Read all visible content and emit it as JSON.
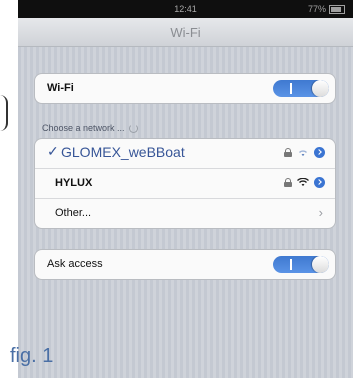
{
  "status_bar": {
    "time": "12:41",
    "battery": "77%"
  },
  "nav": {
    "title": "Wi-Fi"
  },
  "wifi_group": {
    "label": "Wi-Fi",
    "toggle_state": "on"
  },
  "networks_header": "Choose a network ...",
  "networks": [
    {
      "name": "GLOMEX_weBBoat",
      "selected": true,
      "secured": true
    },
    {
      "name": "HYLUX",
      "selected": false,
      "secured": true
    }
  ],
  "other_label": "Other...",
  "ask_group": {
    "label": "Ask access",
    "toggle_state": "on"
  },
  "figure_label": "fig. 1",
  "colors": {
    "accent": "#3f79d0",
    "selected_text": "#375597"
  }
}
